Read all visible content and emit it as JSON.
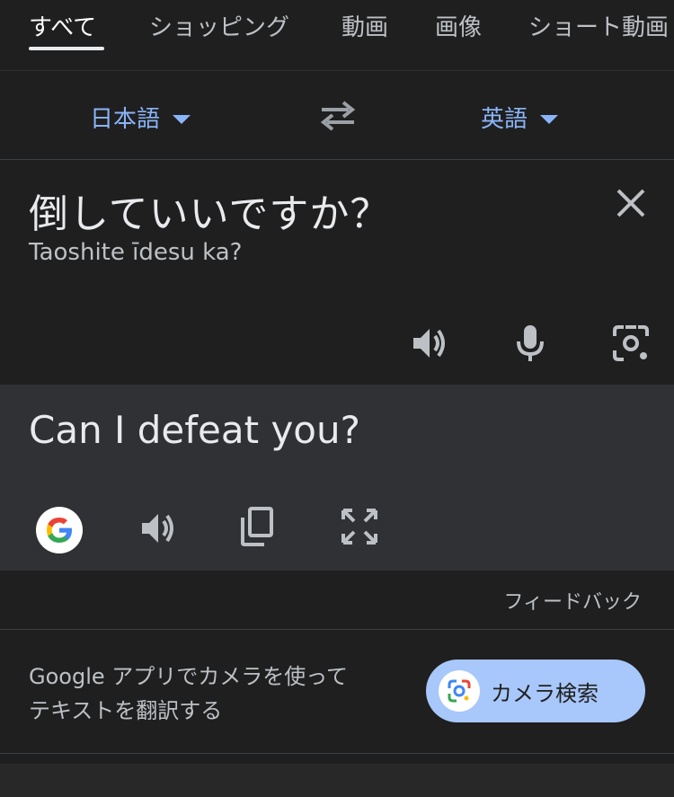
{
  "tabs": [
    {
      "label": "すべて"
    },
    {
      "label": "ショッピング"
    },
    {
      "label": "動画"
    },
    {
      "label": "画像"
    },
    {
      "label": "ショート動画"
    }
  ],
  "languages": {
    "source": "日本語",
    "target": "英語"
  },
  "input": {
    "text": "倒していいですか？",
    "transliteration": "Taoshite īdesu ka?"
  },
  "output": {
    "text": "Can I defeat you?"
  },
  "feedback_label": "フィードバック",
  "promo": {
    "line1": "Google アプリでカメラを使って",
    "line2": "テキストを翻訳する",
    "button_label": "カメラ検索"
  },
  "colors": {
    "accent": "#8ab4f8",
    "background": "#1f1f1f",
    "output_bg": "#303134",
    "button_bg": "#a8c7fa"
  }
}
